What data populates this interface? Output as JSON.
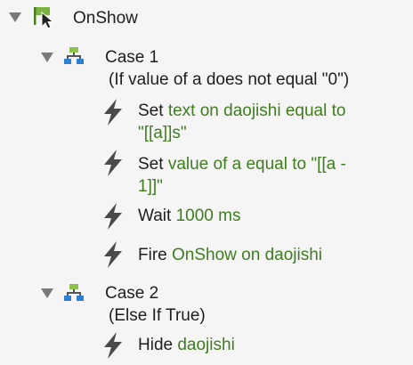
{
  "colors": {
    "background": "#f5f5f5",
    "text": "#1e1e1e",
    "target_green": "#3f7d1e",
    "icon_gray": "#555555",
    "expander_gray": "#7a7a7a",
    "case_icon_green": "#8bc34a",
    "case_icon_blue": "#2f7fd1"
  },
  "event": {
    "label": "OnShow",
    "icon": "event-cursor-flag-icon"
  },
  "cases": [
    {
      "label": "Case 1",
      "condition": "(If value of a does not equal \"0\")",
      "icon": "case-branch-icon",
      "actions": [
        {
          "icon": "lightning-bolt-icon",
          "verb": "Set",
          "detail_line1": "text on daojishi equal to",
          "detail_line2": "\"[[a]]s\""
        },
        {
          "icon": "lightning-bolt-icon",
          "verb": "Set",
          "detail_line1": "value of a equal to \"[[a -",
          "detail_line2": "1]]\""
        },
        {
          "icon": "lightning-bolt-icon",
          "verb": "Wait",
          "detail_line1": "1000 ms"
        },
        {
          "icon": "lightning-bolt-icon",
          "verb": "Fire",
          "detail_line1": "OnShow on daojishi"
        }
      ]
    },
    {
      "label": "Case 2",
      "condition": "(Else If True)",
      "icon": "case-branch-icon",
      "actions": [
        {
          "icon": "lightning-bolt-icon",
          "verb": "Hide",
          "detail_line1": "daojishi"
        }
      ]
    }
  ]
}
